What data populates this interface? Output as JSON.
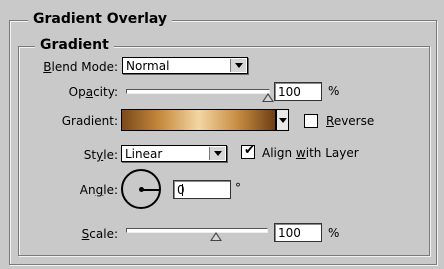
{
  "section_title": "Gradient Overlay",
  "subsection_title": "Gradient",
  "blend_mode": {
    "label_accel": "B",
    "label_rest": "lend Mode:",
    "value": "Normal"
  },
  "opacity": {
    "label_pre": "Op",
    "label_accel": "a",
    "label_rest": "city:",
    "value": "100",
    "unit": "%",
    "level": 100
  },
  "gradient": {
    "label": "Gradient:",
    "reverse_accel": "R",
    "reverse_rest": "everse",
    "reverse_checked": false,
    "colors": [
      "#7a4a1c",
      "#c78a3e",
      "#f2d6a3",
      "#c98e45",
      "#6e3f14"
    ]
  },
  "style": {
    "label_pre": "St",
    "label_accel": "y",
    "label_rest": "le:",
    "value": "Linear",
    "align_pre": "Align ",
    "align_accel": "w",
    "align_rest": "ith Layer",
    "align_checked": true
  },
  "angle": {
    "label_pre": "An",
    "label_accel": "g",
    "label_rest": "le:",
    "value": "0",
    "unit": "°",
    "degrees": 0
  },
  "scale": {
    "label_accel": "S",
    "label_rest": "cale:",
    "value": "100",
    "unit": "%",
    "level": 100,
    "level_min": 10,
    "level_max": 150
  }
}
